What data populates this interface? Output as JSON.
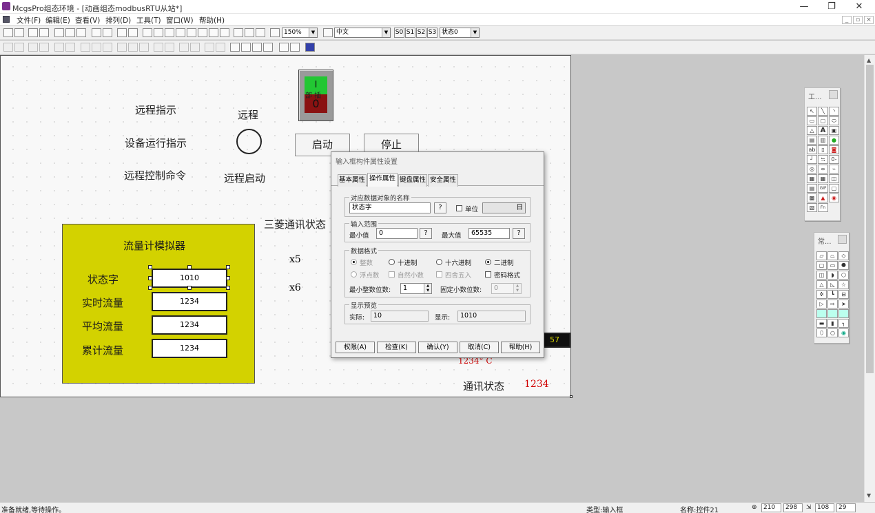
{
  "window": {
    "title": "McgsPro组态环境 - [动画组态modbusRTU从站*]",
    "minimize_glyph": "—",
    "maximize_glyph": "❐",
    "close_glyph": "✕"
  },
  "menu": {
    "items": [
      "文件(F)",
      "编辑(E)",
      "查看(V)",
      "排列(D)",
      "工具(T)",
      "窗口(W)",
      "帮助(H)"
    ]
  },
  "toolbar": {
    "zoom": "150%",
    "language": "中文",
    "state_buttons": [
      "S0",
      "S1",
      "S2",
      "S3"
    ],
    "state_select": "状态0"
  },
  "canvas": {
    "labels": {
      "remote_indicator": "远程指示",
      "remote": "远程",
      "equipment_run": "设备运行指示",
      "remote_cmd": "远程控制命令",
      "remote_start": "远程启动",
      "mitsubishi_comm": "三菱通讯状态",
      "x5": "x5",
      "x6": "x6",
      "temp_value": "1234° C",
      "comm_status": "通讯状态",
      "comm_value": "1234"
    },
    "toggle": {
      "top": "I",
      "bottom": "0",
      "overlay": "部 插"
    },
    "start_button": "启动",
    "stop_button": "停止",
    "partial_value": "57",
    "flow_panel": {
      "title": "流量计模拟器",
      "rows": [
        {
          "label": "状态字",
          "value": "1010"
        },
        {
          "label": "实时流量",
          "value": "1234"
        },
        {
          "label": "平均流量",
          "value": "1234"
        },
        {
          "label": "累计流量",
          "value": "1234"
        }
      ]
    }
  },
  "palettes": {
    "tools_title": "工...",
    "common_title": "常..."
  },
  "dialog": {
    "title": "输入框构件属性设置",
    "tabs": [
      "基本属性",
      "操作属性",
      "键盘属性",
      "安全属性"
    ],
    "active_tab": "操作属性",
    "data_object_group": "对应数据对象的名称",
    "data_object_value": "状态字",
    "q": "?",
    "unit_label": "单位",
    "unit_icon_text": "日",
    "range_group": "输入范围",
    "min_label": "最小值",
    "min_value": "0",
    "max_label": "最大值",
    "max_value": "65535",
    "format_group": "数据格式",
    "radio_int": "整数",
    "radio_dec": "十进制",
    "radio_hex": "十六进制",
    "radio_bin": "二进制",
    "radio_float": "浮点数",
    "chk_natural": "自然小数",
    "chk_round": "四舍五入",
    "chk_password": "密码格式",
    "min_dec_label": "最小整数位数:",
    "min_dec_value": "1",
    "fixed_dec_label": "固定小数位数:",
    "fixed_dec_value": "0",
    "preview_group": "显示预览",
    "actual_label": "实际:",
    "actual_value": "10",
    "display_label": "显示:",
    "display_value": "1010",
    "buttons": [
      "权限(A)",
      "检查(K)",
      "确认(Y)",
      "取消(C)",
      "帮助(H)"
    ]
  },
  "statusbar": {
    "message": "准备就绪,等待操作。",
    "type_text": "类型:输入框",
    "name_text": "名称:控件21",
    "x": "210",
    "y": "298",
    "w": "108",
    "h": "29"
  }
}
